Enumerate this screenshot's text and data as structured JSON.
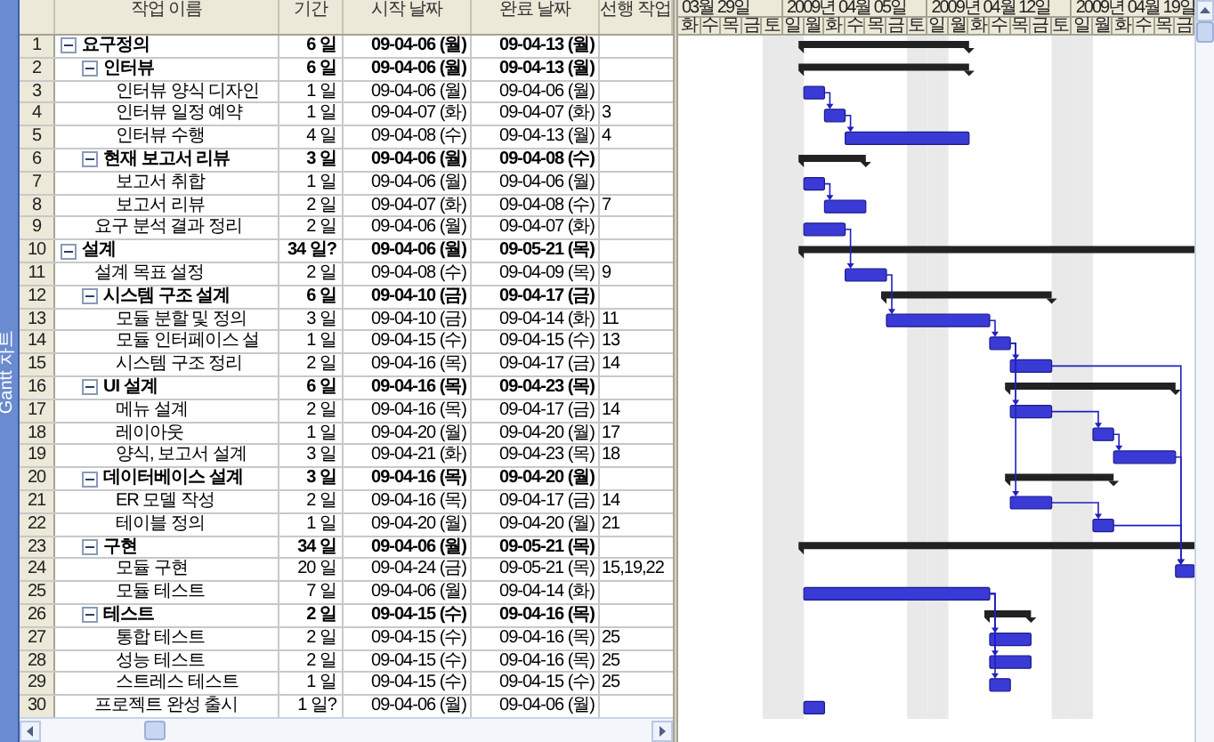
{
  "side_tab": {
    "label": "Gantt 차트"
  },
  "table": {
    "columns": [
      "작업 이름",
      "기간",
      "시작 날짜",
      "완료 날짜",
      "선행 작업"
    ],
    "rows": [
      {
        "id": "1",
        "kind": "summary",
        "expanded": true,
        "name": "요구정의",
        "duration": "6 일",
        "start": "09-04-06 (월)",
        "finish": "09-04-13 (월)",
        "children": [
          {
            "id": "2",
            "kind": "summary",
            "expanded": true,
            "name": "인터뷰",
            "duration": "6 일",
            "start": "09-04-06 (월)",
            "finish": "09-04-13 (월)",
            "children": [
              {
                "id": "3",
                "kind": "task",
                "name": "인터뷰 양식 디자인",
                "duration": "1 일",
                "start": "09-04-06 (월)",
                "finish": "09-04-06 (월)"
              },
              {
                "id": "4",
                "kind": "task",
                "name": "인터뷰 일정 예약",
                "duration": "1 일",
                "start": "09-04-07 (화)",
                "finish": "09-04-07 (화)",
                "predecessors": "3"
              },
              {
                "id": "5",
                "kind": "task",
                "name": "인터뷰 수행",
                "duration": "4 일",
                "start": "09-04-08 (수)",
                "finish": "09-04-13 (월)",
                "predecessors": "4"
              }
            ]
          },
          {
            "id": "6",
            "kind": "summary",
            "expanded": true,
            "name": "현재 보고서 리뷰",
            "duration": "3 일",
            "start": "09-04-06 (월)",
            "finish": "09-04-08 (수)",
            "children": [
              {
                "id": "7",
                "kind": "task",
                "name": "보고서 취합",
                "duration": "1 일",
                "start": "09-04-06 (월)",
                "finish": "09-04-06 (월)"
              },
              {
                "id": "8",
                "kind": "task",
                "name": "보고서 리뷰",
                "duration": "2 일",
                "start": "09-04-07 (화)",
                "finish": "09-04-08 (수)",
                "predecessors": "7"
              }
            ]
          },
          {
            "id": "9",
            "kind": "task",
            "name": "요구 분석 결과 정리",
            "duration": "2 일",
            "start": "09-04-06 (월)",
            "finish": "09-04-07 (화)"
          }
        ]
      },
      {
        "id": "10",
        "kind": "summary",
        "expanded": true,
        "name": "설계",
        "duration": "34 일?",
        "start": "09-04-06 (월)",
        "finish": "09-05-21 (목)",
        "children": [
          {
            "id": "11",
            "kind": "task",
            "name": "설계 목표 설정",
            "duration": "2 일",
            "start": "09-04-08 (수)",
            "finish": "09-04-09 (목)",
            "predecessors": "9"
          },
          {
            "id": "12",
            "kind": "summary",
            "expanded": true,
            "name": "시스템 구조 설계",
            "duration": "6 일",
            "start": "09-04-10 (금)",
            "finish": "09-04-17 (금)",
            "children": [
              {
                "id": "13",
                "kind": "task",
                "name": "모듈 분할 및 정의",
                "duration": "3 일",
                "start": "09-04-10 (금)",
                "finish": "09-04-14 (화)",
                "predecessors": "11"
              },
              {
                "id": "14",
                "kind": "task",
                "name": "모듈 인터페이스 설",
                "duration": "1 일",
                "start": "09-04-15 (수)",
                "finish": "09-04-15 (수)",
                "predecessors": "13"
              },
              {
                "id": "15",
                "kind": "task",
                "name": "시스템 구조 정리",
                "duration": "2 일",
                "start": "09-04-16 (목)",
                "finish": "09-04-17 (금)",
                "predecessors": "14"
              }
            ]
          },
          {
            "id": "16",
            "kind": "summary",
            "expanded": true,
            "name": "UI 설계",
            "duration": "6 일",
            "start": "09-04-16 (목)",
            "finish": "09-04-23 (목)",
            "children": [
              {
                "id": "17",
                "kind": "task",
                "name": "메뉴 설계",
                "duration": "2 일",
                "start": "09-04-16 (목)",
                "finish": "09-04-17 (금)",
                "predecessors": "14"
              },
              {
                "id": "18",
                "kind": "task",
                "name": "레이아웃",
                "duration": "1 일",
                "start": "09-04-20 (월)",
                "finish": "09-04-20 (월)",
                "predecessors": "17"
              },
              {
                "id": "19",
                "kind": "task",
                "name": "양식, 보고서 설계",
                "duration": "3 일",
                "start": "09-04-21 (화)",
                "finish": "09-04-23 (목)",
                "predecessors": "18"
              }
            ]
          },
          {
            "id": "20",
            "kind": "summary",
            "expanded": true,
            "name": "데이터베이스 설계",
            "duration": "3 일",
            "start": "09-04-16 (목)",
            "finish": "09-04-20 (월)",
            "children": [
              {
                "id": "21",
                "kind": "task",
                "name": "ER 모델 작성",
                "duration": "2 일",
                "start": "09-04-16 (목)",
                "finish": "09-04-17 (금)",
                "predecessors": "14"
              },
              {
                "id": "22",
                "kind": "task",
                "name": "테이블 정의",
                "duration": "1 일",
                "start": "09-04-20 (월)",
                "finish": "09-04-20 (월)",
                "predecessors": "21"
              }
            ]
          },
          {
            "id": "23",
            "kind": "summary",
            "expanded": true,
            "name": "구현",
            "duration": "34 일",
            "start": "09-04-06 (월)",
            "finish": "09-05-21 (목)",
            "children": [
              {
                "id": "24",
                "kind": "task",
                "name": "모듈 구현",
                "duration": "20 일",
                "start": "09-04-24 (금)",
                "finish": "09-05-21 (목)",
                "predecessors": "15,19,22"
              },
              {
                "id": "25",
                "kind": "task",
                "name": "모듈 테스트",
                "duration": "7 일",
                "start": "09-04-06 (월)",
                "finish": "09-04-14 (화)"
              }
            ]
          },
          {
            "id": "26",
            "kind": "summary",
            "expanded": true,
            "name": "테스트",
            "duration": "2 일",
            "start": "09-04-15 (수)",
            "finish": "09-04-16 (목)",
            "children": [
              {
                "id": "27",
                "kind": "task",
                "name": "통합 테스트",
                "duration": "2 일",
                "start": "09-04-15 (수)",
                "finish": "09-04-16 (목)",
                "predecessors": "25"
              },
              {
                "id": "28",
                "kind": "task",
                "name": "성능 테스트",
                "duration": "2 일",
                "start": "09-04-15 (수)",
                "finish": "09-04-16 (목)",
                "predecessors": "25"
              },
              {
                "id": "29",
                "kind": "task",
                "name": "스트레스 테스트",
                "duration": "1 일",
                "start": "09-04-15 (수)",
                "finish": "09-04-15 (수)",
                "predecessors": "25"
              }
            ]
          },
          {
            "id": "30",
            "kind": "task",
            "name": "프로젝트 완성 출시",
            "duration": "1 일?",
            "start": "09-04-06 (월)",
            "finish": "09-04-06 (월)"
          }
        ]
      }
    ]
  },
  "gantt": {
    "weeks": [
      "03월 29일",
      "2009년 04월 05일",
      "2009년 04월 12일",
      "2009년 04월 19일"
    ],
    "days": [
      "화",
      "수",
      "목",
      "금",
      "토",
      "일",
      "월",
      "화",
      "수",
      "목",
      "금",
      "토",
      "일",
      "월",
      "화",
      "수",
      "목",
      "금",
      "토",
      "일",
      "월",
      "화",
      "수",
      "목",
      "금"
    ]
  }
}
